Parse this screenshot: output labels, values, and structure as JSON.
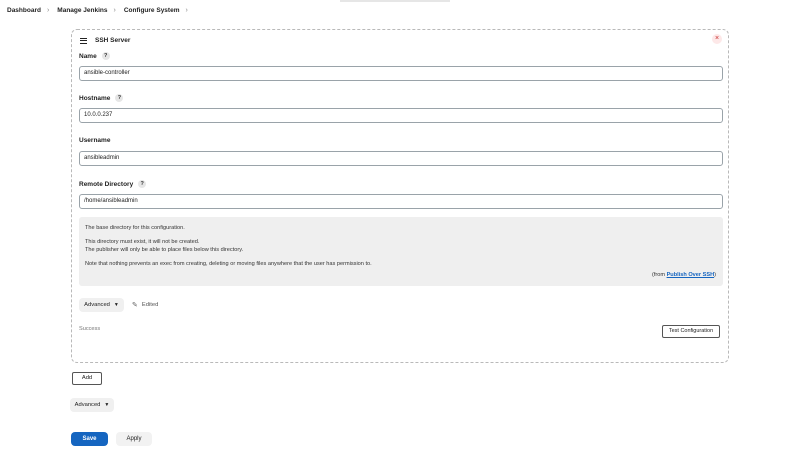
{
  "breadcrumb": {
    "items": [
      "Dashboard",
      "Manage Jenkins",
      "Configure System"
    ],
    "separator": "›"
  },
  "ssh_server": {
    "title": "SSH Server",
    "close_symbol": "×",
    "name": {
      "label": "Name",
      "value": "ansible-controller"
    },
    "hostname": {
      "label": "Hostname",
      "value": "10.0.0.237"
    },
    "username": {
      "label": "Username",
      "value": "ansibleadmin"
    },
    "remote_directory": {
      "label": "Remote Directory",
      "value": "/home/ansibleadmin"
    },
    "help_symbol": "?",
    "help": {
      "line1": "The base directory for this configuration.",
      "line2": "This directory must exist, it will not be created.",
      "line3": "The publisher will only be able to place files below this directory.",
      "line4": "Note that nothing prevents an exec from creating, deleting or moving files anywhere that the user has permission to.",
      "from_prefix": "(from ",
      "from_link": "Publish Over SSH",
      "from_suffix": ")"
    },
    "advanced_label": "Advanced",
    "edited_label": "Edited",
    "status_text": "Success",
    "test_config_label": "Test Configuration"
  },
  "add_label": "Add",
  "global_advanced_label": "Advanced",
  "save_label": "Save",
  "apply_label": "Apply",
  "colors": {
    "primary": "#1565c0",
    "close_icon": "#c62828"
  }
}
